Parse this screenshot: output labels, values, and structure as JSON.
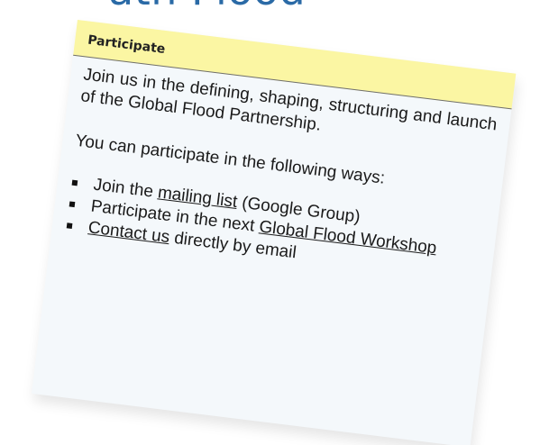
{
  "background": {
    "heading": "ath Flood",
    "accent_color": "#2a6aa6"
  },
  "panel": {
    "header_color": "#fbf6a3",
    "title": "Participate",
    "intro": "Join us in the defining, shaping, structuring and launch of the Global Flood Partnership.",
    "lead": "You can participate in the following ways:",
    "items": [
      {
        "before": "Join the ",
        "link": "mailing list",
        "after": " (Google Group)"
      },
      {
        "before": "Participate in the next ",
        "link": "Global Flood Workshop",
        "after": ""
      },
      {
        "before": "",
        "link": "Contact us",
        "after": " directly by email"
      }
    ]
  }
}
